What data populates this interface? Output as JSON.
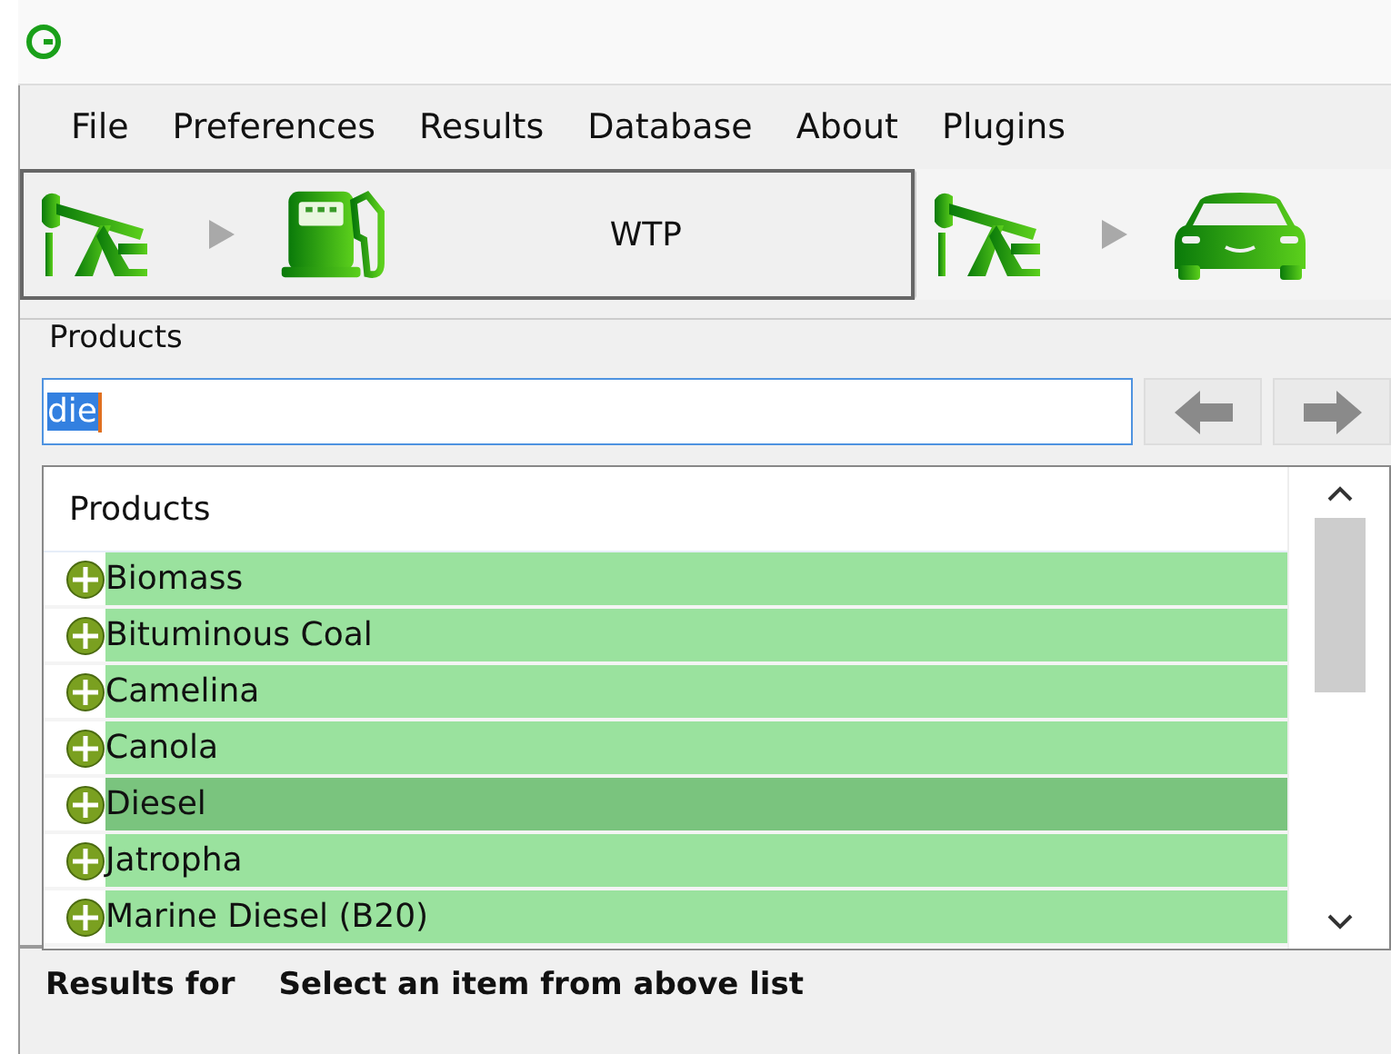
{
  "menu": [
    "File",
    "Preferences",
    "Results",
    "Database",
    "About",
    "Plugins"
  ],
  "toolbar": {
    "tabs": [
      {
        "label": "WTP",
        "kind": "pump",
        "selected": true
      },
      {
        "kind": "car",
        "selected": false
      }
    ]
  },
  "products": {
    "group_title": "Products",
    "search": {
      "value": "die",
      "value_selected": true
    },
    "nav_buttons": [
      {
        "kind": "back",
        "disabled": true
      },
      {
        "kind": "forward",
        "disabled": true
      }
    ],
    "list_header": "Products",
    "items": [
      {
        "label": "Biomass",
        "selected": false
      },
      {
        "label": "Bituminous Coal",
        "selected": false
      },
      {
        "label": "Camelina",
        "selected": false
      },
      {
        "label": "Canola",
        "selected": false
      },
      {
        "label": "Diesel",
        "selected": true
      },
      {
        "label": "Jatropha",
        "selected": false
      },
      {
        "label": "Marine Diesel (B20)",
        "selected": false
      }
    ]
  },
  "status_bar": {
    "label": "Results for",
    "message": "Select an item from above list"
  }
}
